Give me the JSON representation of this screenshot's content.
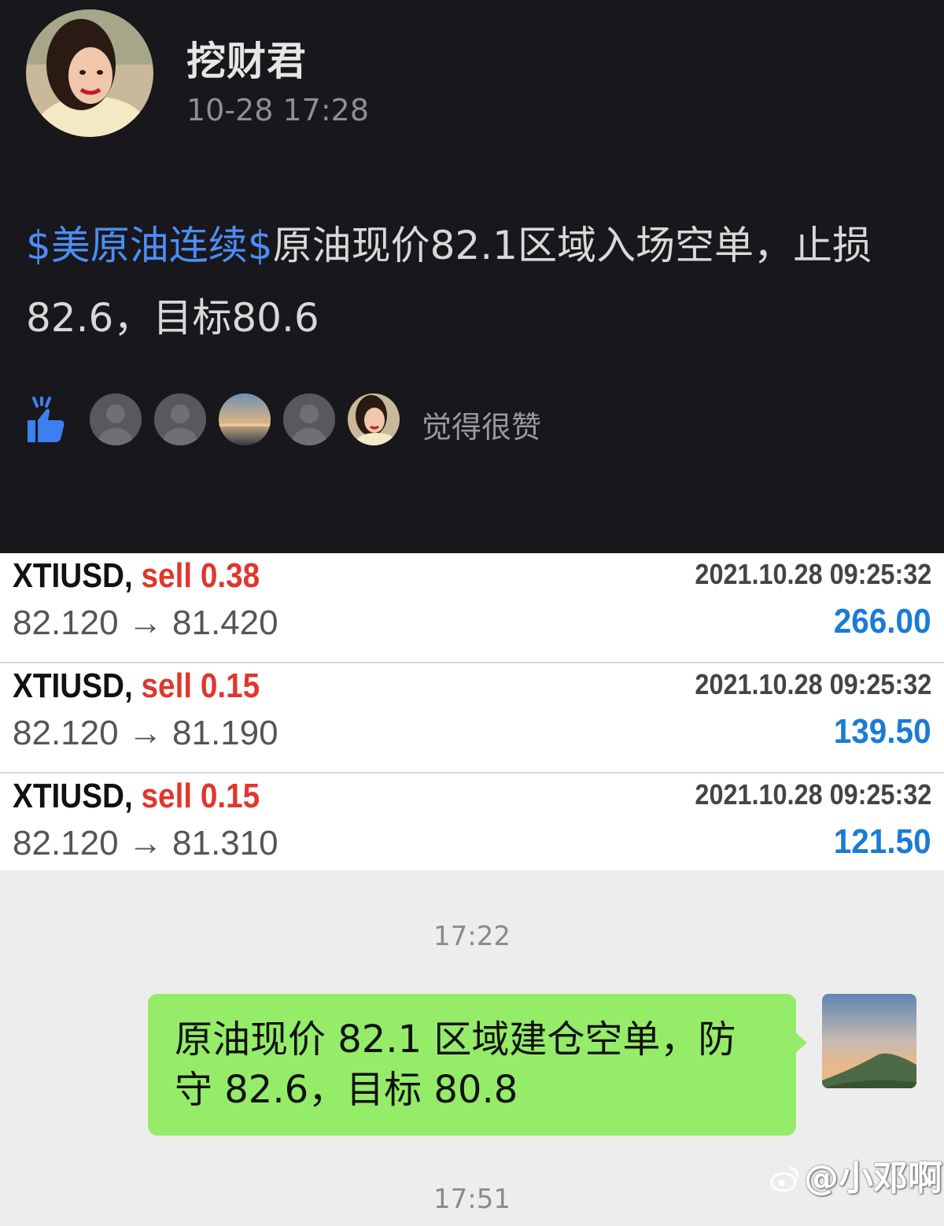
{
  "post": {
    "author": "挖财君",
    "time": "10-28 17:28",
    "tag": "$美原油连续$",
    "body": "原油现价82.1区域入场空单，止损82.6，目标80.6",
    "likes_label": "觉得很赞",
    "tag_color": "#4d8df5"
  },
  "trades": [
    {
      "symbol": "XTIUSD,",
      "side": "sell 0.38",
      "date": "2021.10.28 09:25:32",
      "prices": "82.120 → 81.420",
      "profit": "266.00"
    },
    {
      "symbol": "XTIUSD,",
      "side": "sell 0.15",
      "date": "2021.10.28 09:25:32",
      "prices": "82.120 → 81.190",
      "profit": "139.50"
    },
    {
      "symbol": "XTIUSD,",
      "side": "sell 0.15",
      "date": "2021.10.28 09:25:32",
      "prices": "82.120 → 81.310",
      "profit": "121.50"
    }
  ],
  "chat": {
    "time_1": "17:22",
    "message": "原油现价 82.1 区域建仓空单，防守 82.6，目标 80.8",
    "time_2": "17:51",
    "watermark": "@小邓啊",
    "bubble_color": "#95ec69"
  },
  "icons": [
    "thumbs-up-icon",
    "weibo-logo-icon"
  ]
}
